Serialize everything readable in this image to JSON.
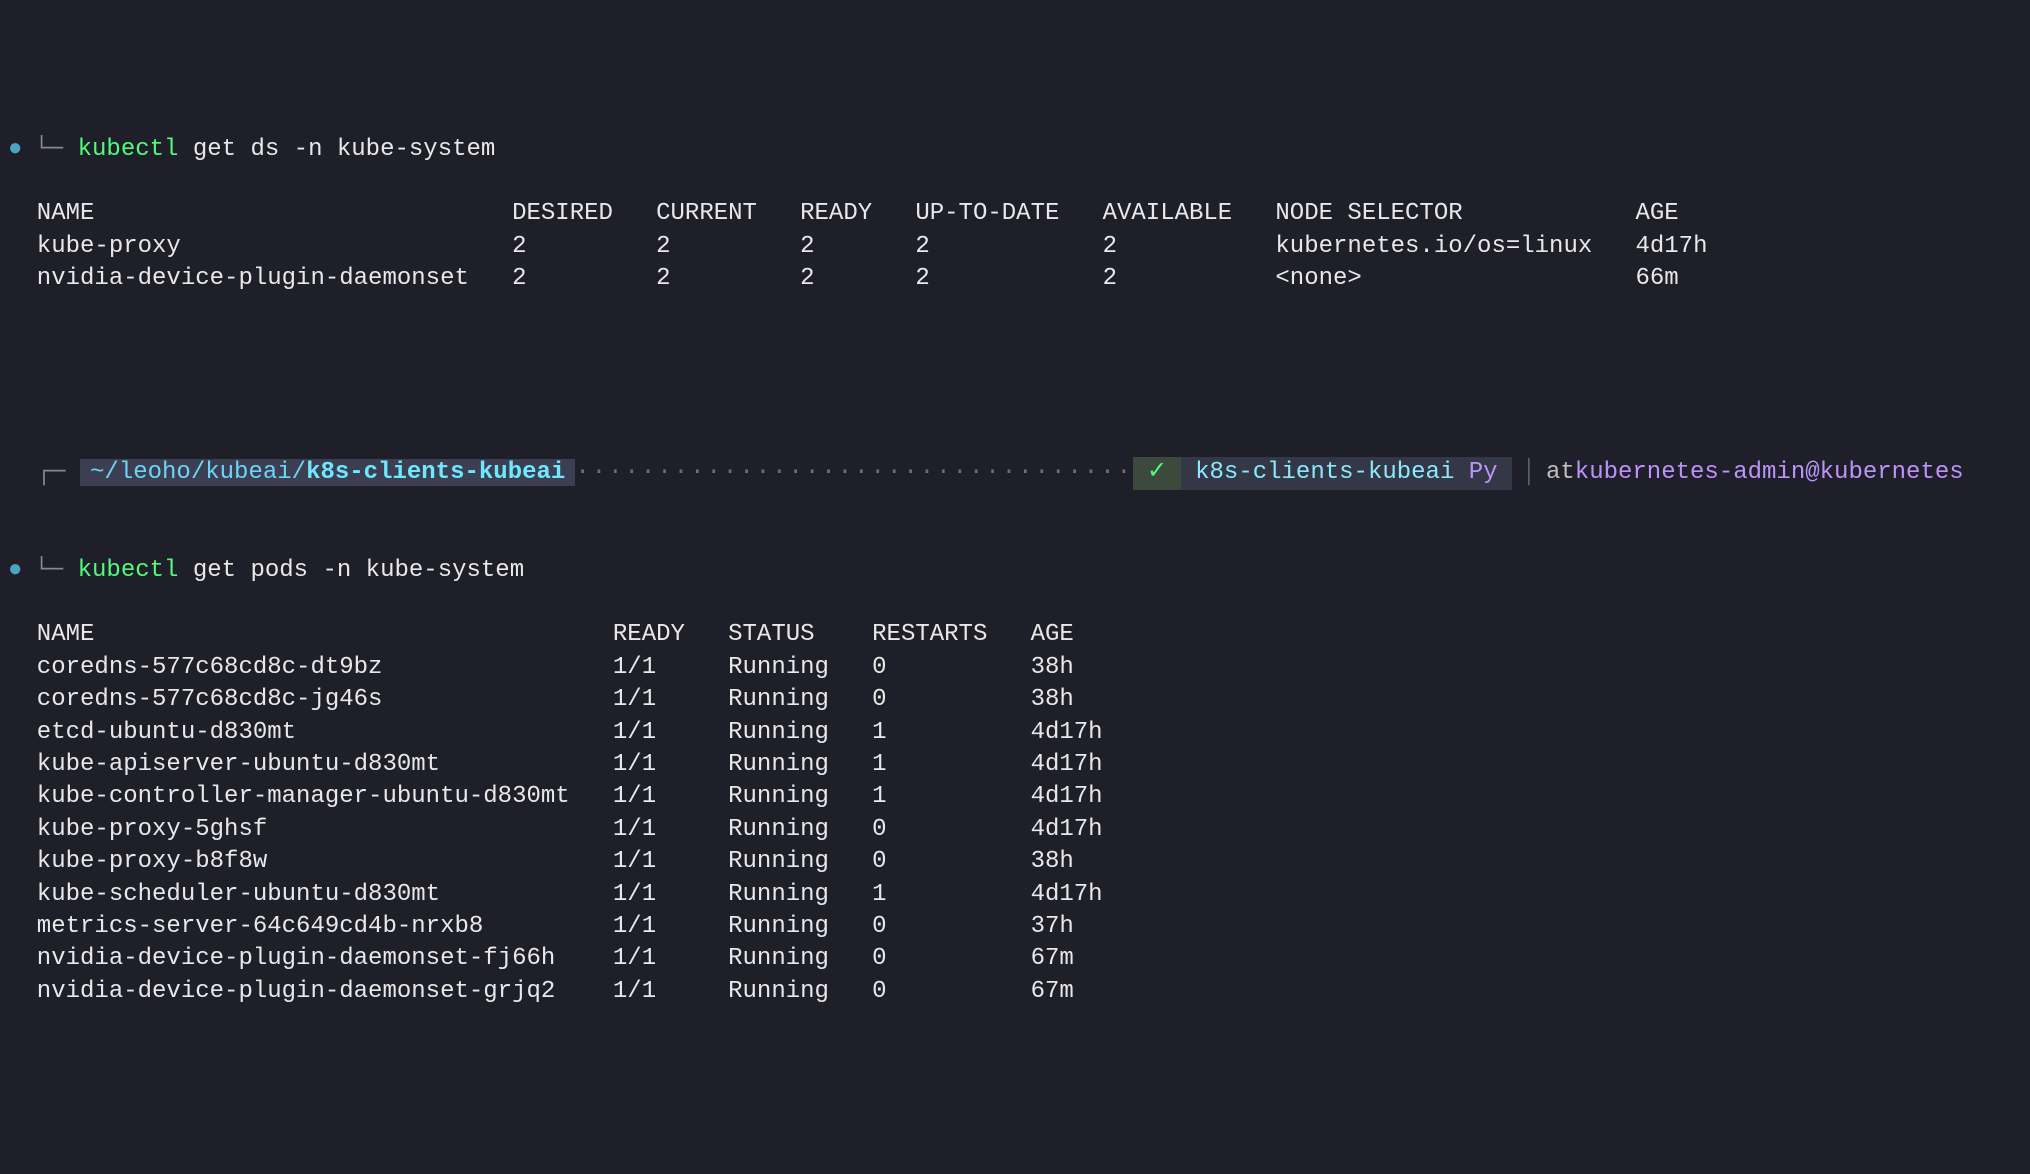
{
  "cmd1": {
    "bullet": "●",
    "branch": "└─",
    "kubectl": "kubectl",
    "rest": " get ds -n kube-system"
  },
  "ds": {
    "hdr": {
      "name": "NAME",
      "desired": "DESIRED",
      "current": "CURRENT",
      "ready": "READY",
      "uptodate": "UP-TO-DATE",
      "available": "AVAILABLE",
      "selector": "NODE SELECTOR",
      "age": "AGE"
    },
    "rows": [
      {
        "name": "kube-proxy",
        "desired": "2",
        "current": "2",
        "ready": "2",
        "uptodate": "2",
        "available": "2",
        "selector": "kubernetes.io/os=linux",
        "age": "4d17h"
      },
      {
        "name": "nvidia-device-plugin-daemonset",
        "desired": "2",
        "current": "2",
        "ready": "2",
        "uptodate": "2",
        "available": "2",
        "selector": "<none>",
        "age": "66m"
      }
    ]
  },
  "prompt": {
    "branch_top": "┌─",
    "path_prefix": "~/leoho/kubeai/",
    "path_tail": "k8s-clients-kubeai",
    "dots": "··································",
    "check": "✓",
    "ctx": "k8s-clients-kubeai",
    "ctx_py": "Py",
    "at": "at",
    "cluster": "kubernetes-admin@kubernetes"
  },
  "cmd2": {
    "bullet": "●",
    "branch": "└─",
    "kubectl": "kubectl",
    "rest": " get pods -n kube-system"
  },
  "pods": {
    "hdr": {
      "name": "NAME",
      "ready": "READY",
      "status": "STATUS",
      "restarts": "RESTARTS",
      "age": "AGE"
    },
    "rows": [
      {
        "name": "coredns-577c68cd8c-dt9bz",
        "ready": "1/1",
        "status": "Running",
        "restarts": "0",
        "age": "38h"
      },
      {
        "name": "coredns-577c68cd8c-jg46s",
        "ready": "1/1",
        "status": "Running",
        "restarts": "0",
        "age": "38h"
      },
      {
        "name": "etcd-ubuntu-d830mt",
        "ready": "1/1",
        "status": "Running",
        "restarts": "1",
        "age": "4d17h"
      },
      {
        "name": "kube-apiserver-ubuntu-d830mt",
        "ready": "1/1",
        "status": "Running",
        "restarts": "1",
        "age": "4d17h"
      },
      {
        "name": "kube-controller-manager-ubuntu-d830mt",
        "ready": "1/1",
        "status": "Running",
        "restarts": "1",
        "age": "4d17h"
      },
      {
        "name": "kube-proxy-5ghsf",
        "ready": "1/1",
        "status": "Running",
        "restarts": "0",
        "age": "4d17h"
      },
      {
        "name": "kube-proxy-b8f8w",
        "ready": "1/1",
        "status": "Running",
        "restarts": "0",
        "age": "38h"
      },
      {
        "name": "kube-scheduler-ubuntu-d830mt",
        "ready": "1/1",
        "status": "Running",
        "restarts": "1",
        "age": "4d17h"
      },
      {
        "name": "metrics-server-64c649cd4b-nrxb8",
        "ready": "1/1",
        "status": "Running",
        "restarts": "0",
        "age": "37h"
      },
      {
        "name": "nvidia-device-plugin-daemonset-fj66h",
        "ready": "1/1",
        "status": "Running",
        "restarts": "0",
        "age": "67m"
      },
      {
        "name": "nvidia-device-plugin-daemonset-grjq2",
        "ready": "1/1",
        "status": "Running",
        "restarts": "0",
        "age": "67m"
      }
    ]
  },
  "widths": {
    "ds": {
      "name": 33,
      "desired": 10,
      "current": 10,
      "ready": 8,
      "uptodate": 13,
      "available": 12,
      "selector": 25,
      "age": 6
    },
    "pods": {
      "name": 40,
      "ready": 8,
      "status": 10,
      "restarts": 11,
      "age": 6
    }
  }
}
